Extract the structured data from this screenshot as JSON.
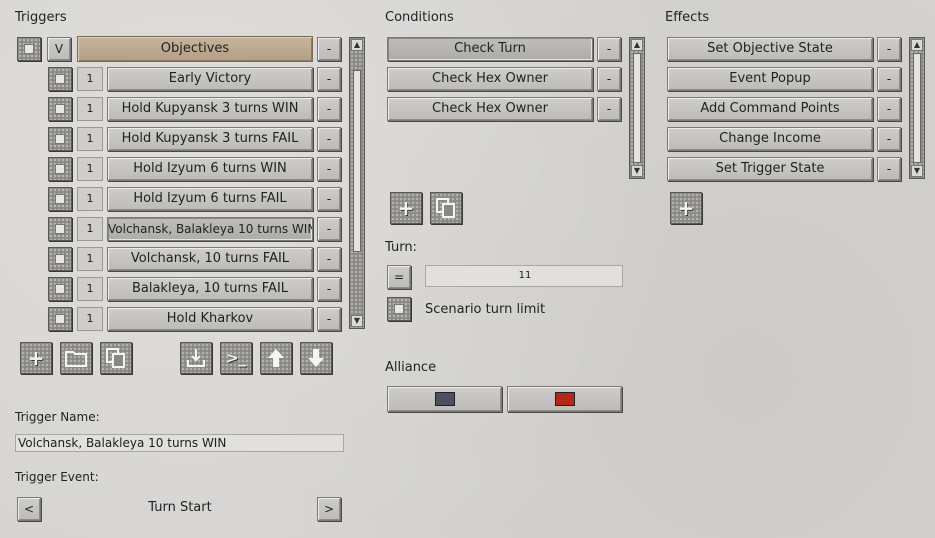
{
  "triggers": {
    "title": "Triggers",
    "header": {
      "check_label": "",
      "v_label": "V",
      "name": "Objectives",
      "remove_label": "-"
    },
    "items": [
      {
        "num": "1",
        "name": "Early Victory",
        "remove_label": "-"
      },
      {
        "num": "1",
        "name": "Hold Kupyansk 3 turns WIN",
        "remove_label": "-"
      },
      {
        "num": "1",
        "name": "Hold Kupyansk 3 turns FAIL",
        "remove_label": "-"
      },
      {
        "num": "1",
        "name": "Hold Izyum 6 turns WIN",
        "remove_label": "-"
      },
      {
        "num": "1",
        "name": "Hold Izyum 6 turns FAIL",
        "remove_label": "-"
      },
      {
        "num": "1",
        "name": "Volchansk, Balakleya 10 turns WIN",
        "remove_label": "-"
      },
      {
        "num": "1",
        "name": "Volchansk, 10 turns FAIL",
        "remove_label": "-"
      },
      {
        "num": "1",
        "name": "Balakleya, 10 turns FAIL",
        "remove_label": "-"
      },
      {
        "num": "1",
        "name": "Hold Kharkov",
        "remove_label": "-"
      }
    ],
    "selected_index": 5
  },
  "toolbar_icons": [
    "add-icon",
    "folder-icon",
    "copy-icon",
    "import-icon",
    "console-icon",
    "move-up-icon",
    "move-down-icon"
  ],
  "trigger_name": {
    "label": "Trigger Name:",
    "value": "Volchansk, Balakleya 10 turns WIN"
  },
  "trigger_event": {
    "label": "Trigger Event:",
    "value": "Turn Start",
    "prev": "<",
    "next": ">"
  },
  "conditions": {
    "title": "Conditions",
    "items": [
      {
        "name": "Check Turn",
        "remove_label": "-"
      },
      {
        "name": "Check Hex Owner",
        "remove_label": "-"
      },
      {
        "name": "Check Hex Owner",
        "remove_label": "-"
      }
    ],
    "turn_label": "Turn:",
    "operator": "=",
    "turn_value": "11",
    "scenario_limit_label": "Scenario turn limit",
    "alliance_label": "Alliance",
    "alliance_colors": [
      "#4a5260",
      "#b5261b"
    ]
  },
  "effects": {
    "title": "Effects",
    "items": [
      {
        "name": "Set Objective State",
        "remove_label": "-"
      },
      {
        "name": "Event Popup",
        "remove_label": "-"
      },
      {
        "name": "Add Command Points",
        "remove_label": "-"
      },
      {
        "name": "Change Income",
        "remove_label": "-"
      },
      {
        "name": "Set Trigger State",
        "remove_label": "-"
      }
    ]
  }
}
